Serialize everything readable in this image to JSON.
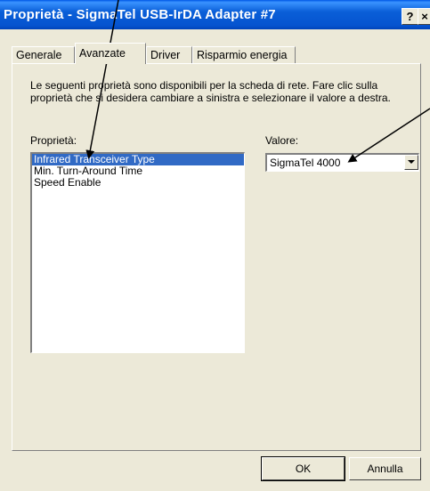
{
  "window": {
    "title": "Proprietà - SigmaTel USB-IrDA Adapter #7",
    "help_label": "?",
    "close_label": "×"
  },
  "tabs": [
    {
      "label": "Generale"
    },
    {
      "label": "Avanzate"
    },
    {
      "label": "Driver"
    },
    {
      "label": "Risparmio energia"
    }
  ],
  "panel": {
    "description": "Le seguenti proprietà sono disponibili per la scheda di rete. Fare clic sulla proprietà che si desidera cambiare a sinistra e selezionare il valore a destra.",
    "property_label": "Proprietà:",
    "value_label": "Valore:",
    "properties": [
      "Infrared Transceiver Type",
      "Min. Turn-Around Time",
      "Speed Enable"
    ],
    "selected_value": "SigmaTel 4000"
  },
  "buttons": {
    "ok": "OK",
    "cancel": "Annulla"
  },
  "colors": {
    "titlebar": "#0553cf",
    "selection": "#316ac5",
    "dialog_bg": "#ece9d8"
  }
}
